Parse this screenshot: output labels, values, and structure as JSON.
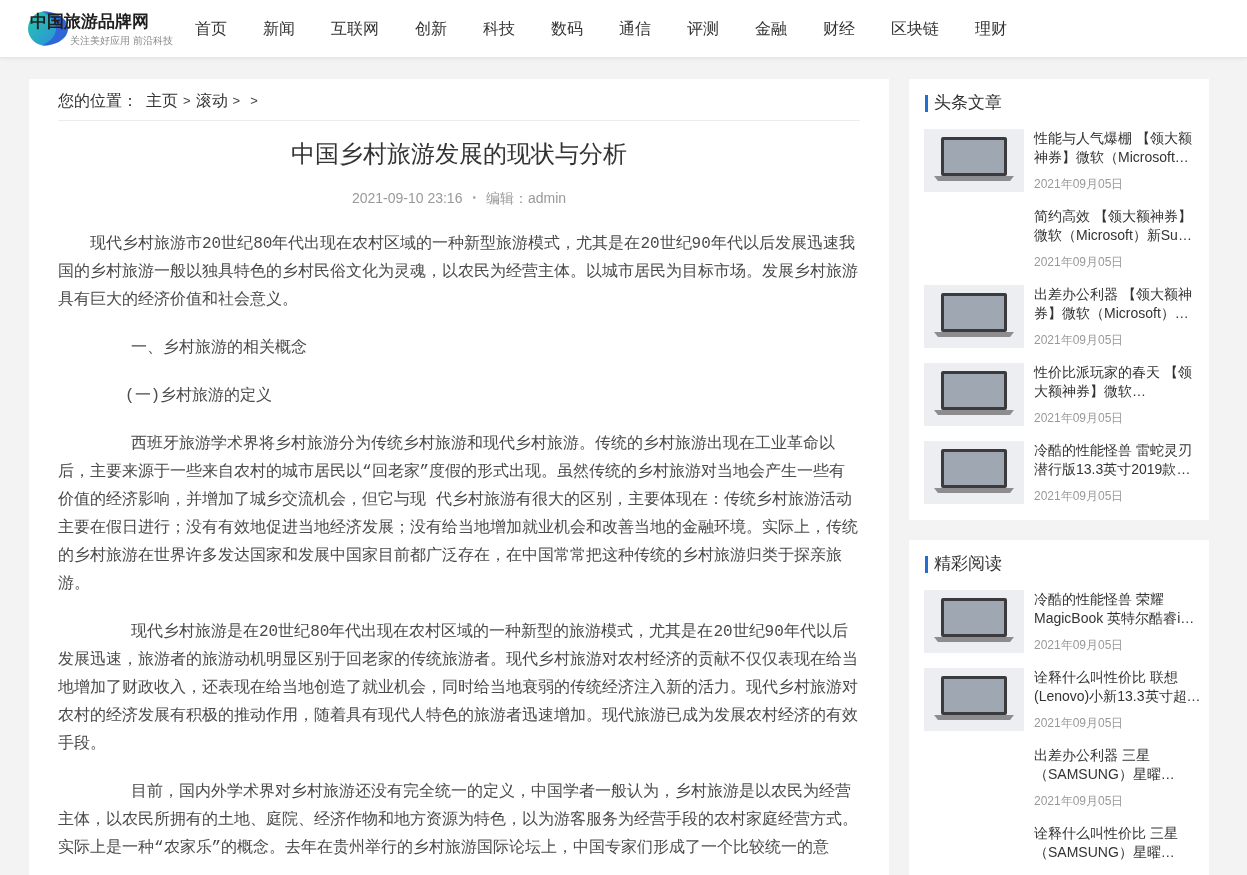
{
  "header": {
    "logo": {
      "name": "中国旅游品牌网",
      "tagline": "关注美好应用 前沿科技"
    },
    "nav": [
      {
        "label": "首页"
      },
      {
        "label": "新闻"
      },
      {
        "label": "互联网"
      },
      {
        "label": "创新"
      },
      {
        "label": "科技"
      },
      {
        "label": "数码"
      },
      {
        "label": "通信"
      },
      {
        "label": "评测"
      },
      {
        "label": "金融"
      },
      {
        "label": "财经"
      },
      {
        "label": "区块链"
      },
      {
        "label": "理财"
      }
    ]
  },
  "breadcrumb": {
    "prefix": "您的位置：",
    "items": [
      {
        "kind": "link",
        "text": "主页"
      },
      {
        "kind": "separator",
        "text": ">"
      },
      {
        "kind": "link",
        "text": "滚动"
      },
      {
        "kind": "separator",
        "text": ">"
      },
      {
        "kind": "separator",
        "text": ">"
      }
    ]
  },
  "article": {
    "title": "中国乡村旅游发展的现状与分析",
    "date": "2021-09-10 23:16",
    "dot": "•",
    "author": "编辑：admin",
    "paragraphs": [
      {
        "kind": "intro",
        "text": "现代乡村旅游市20世纪80年代出现在农村区域的一种新型旅游模式，尤其是在20世纪90年代以后发展迅速我国的乡村旅游一般以独具特色的乡村民俗文化为灵魂，以农民为经营主体。以城市居民为目标市场。发展乡村旅游具有巨大的经济价值和社会意义。"
      },
      {
        "kind": "heading",
        "text": "一、乡村旅游的相关概念"
      },
      {
        "kind": "subheading",
        "text": "(一)乡村旅游的定义"
      },
      {
        "kind": "paragraph",
        "text": "西班牙旅游学术界将乡村旅游分为传统乡村旅游和现代乡村旅游。传统的乡村旅游出现在工业革命以后，主要来源于一些来自农村的城市居民以“回老家”度假的形式出现。虽然传统的乡村旅游对当地会产生一些有价值的经济影响，并增加了城乡交流机会，但它与现 代乡村旅游有很大的区别，主要体现在：传统乡村旅游活动主要在假日进行；没有有效地促进当地经济发展；没有给当地增加就业机会和改善当地的金融环境。实际上，传统的乡村旅游在世界许多发达国家和发展中国家目前都广泛存在，在中国常常把这种传统的乡村旅游归类于探亲旅游。"
      },
      {
        "kind": "paragraph",
        "text": "现代乡村旅游是在20世纪80年代出现在农村区域的一种新型的旅游模式，尤其是在20世纪90年代以后发展迅速，旅游者的旅游动机明显区别于回老家的传统旅游者。现代乡村旅游对农村经济的贡献不仅仅表现在给当地增加了财政收入，还表现在给当地创造了就业机会，同时给当地衰弱的传统经济注入新的活力。现代乡村旅游对农村的经济发展有积极的推动作用，随着具有现代人特色的旅游者迅速增加。现代旅游已成为发展农村经济的有效手段。"
      },
      {
        "kind": "paragraph",
        "text": "目前，国内外学术界对乡村旅游还没有完全统一的定义，中国学者一般认为，乡村旅游是以农民为经营主体，以农民所拥有的土地、庭院、经济作物和地方资源为特色，以为游客服务为经营手段的农村家庭经营方式。实际上是一种“农家乐”的概念。去年在贵州举行的乡村旅游国际论坛上，中国专家们形成了一个比较统一的意"
      }
    ]
  },
  "sidebar": [
    {
      "title": "头条文章",
      "items": [
        {
          "title": "性能与人气爆棚 【领大额神券】微软（Microsoft…",
          "date": "2021年09月05日",
          "photo": true
        },
        {
          "title": "简约高效 【领大额神券】微软（Microsoft）新Su…",
          "date": "2021年09月05日",
          "photo": false
        },
        {
          "title": "出差办公利器 【领大额神券】微软（Microsoft）…",
          "date": "2021年09月05日",
          "photo": true
        },
        {
          "title": "性价比派玩家的春天 【领大额神券】微软…",
          "date": "2021年09月05日",
          "photo": true
        },
        {
          "title": "冷酷的性能怪兽 雷蛇灵刃潜行版13.3英寸2019款…",
          "date": "2021年09月05日",
          "photo": true
        }
      ]
    },
    {
      "title": "精彩阅读",
      "items": [
        {
          "title": "冷酷的性能怪兽 荣耀MagicBook 英特尔酷睿i…",
          "date": "2021年09月05日",
          "photo": true
        },
        {
          "title": "诠释什么叫性价比 联想(Lenovo)小新13.3英寸超…",
          "date": "2021年09月05日",
          "photo": true
        },
        {
          "title": "出差办公利器 三星（SAMSUNG）星曜…",
          "date": "2021年09月05日",
          "photo": false
        },
        {
          "title": "诠释什么叫性价比 三星（SAMSUNG）星曜…",
          "photo": false
        }
      ]
    }
  ]
}
